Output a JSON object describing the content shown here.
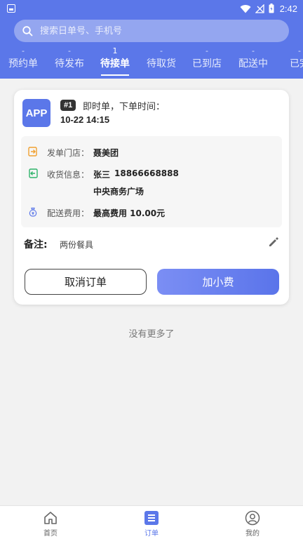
{
  "statusbar": {
    "time": "2:42"
  },
  "search": {
    "placeholder": "搜索日单号、手机号"
  },
  "tabs": [
    {
      "label": "预约单",
      "count": "-"
    },
    {
      "label": "待发布",
      "count": "-"
    },
    {
      "label": "待接单",
      "count": "1"
    },
    {
      "label": "待取货",
      "count": "-"
    },
    {
      "label": "已到店",
      "count": "-"
    },
    {
      "label": "配送中",
      "count": "-"
    },
    {
      "label": "已完",
      "count": "-"
    }
  ],
  "order": {
    "source": "APP",
    "number": "#1",
    "type_text": "即时单，下单时间：",
    "time": "10-22 14:15",
    "store_label": "发单门店：",
    "store_value": "聂美团",
    "receiver_label": "收货信息：",
    "receiver_name": "张三",
    "receiver_phone": "18866668888",
    "receiver_address": "中央商务广场",
    "fee_label": "配送费用：",
    "fee_value": "最高费用 10.00元",
    "note_label": "备注:",
    "note_value": "两份餐具",
    "cancel_label": "取消订单",
    "tip_label": "加小费"
  },
  "list": {
    "end_text": "没有更多了"
  },
  "nav": [
    {
      "label": "首页"
    },
    {
      "label": "订单"
    },
    {
      "label": "我的"
    }
  ],
  "colors": {
    "primary": "#5b77e9",
    "background": "#f2f2f2"
  }
}
